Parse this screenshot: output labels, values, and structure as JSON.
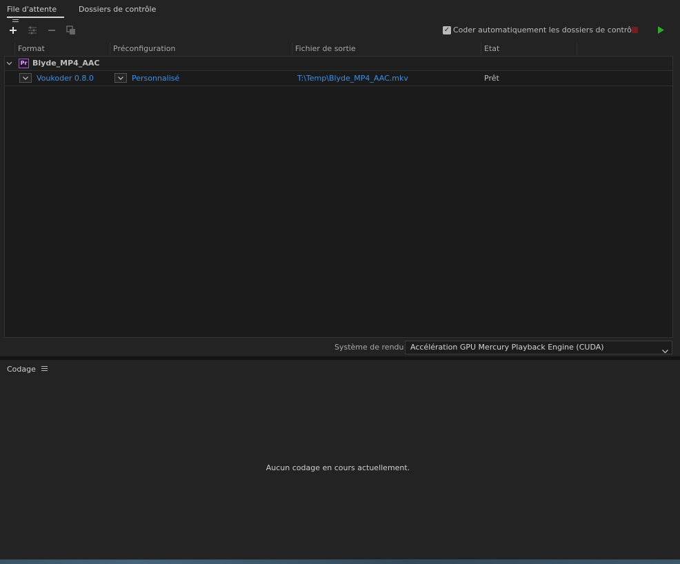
{
  "tabs": [
    {
      "label": "File d'attente",
      "active": true
    },
    {
      "label": "Dossiers de contrôle",
      "active": false
    }
  ],
  "toolbar": {
    "add": "add-icon",
    "settings": "settings-sliders-icon",
    "remove": "remove-icon",
    "duplicate": "duplicate-icon",
    "auto_encode_label": "Coder automatiquement les dossiers de contrôle",
    "auto_encode_checked": true,
    "stop_color": "#7a1f1f",
    "play_color": "#2faa2f"
  },
  "columns": [
    "Format",
    "Préconfiguration",
    "Fichier de sortie",
    "Etat"
  ],
  "queue": {
    "group": {
      "name": "Blyde_MP4_AAC",
      "badge": "Pr"
    },
    "items": [
      {
        "format": "Voukoder 0.8.0",
        "preset": "Personnalisé",
        "output": "T:\\Temp\\Blyde_MP4_AAC.mkv",
        "status": "Prêt"
      }
    ]
  },
  "render": {
    "label": "Système de rendu :",
    "value": "Accélération GPU Mercury Playback Engine (CUDA)"
  },
  "encoding": {
    "title": "Codage",
    "empty_message": "Aucun codage en cours actuellement."
  },
  "colors": {
    "link_blue": "#3b8fe6",
    "panel_bg": "#232323",
    "pr_purple": "#9b5fc4"
  }
}
